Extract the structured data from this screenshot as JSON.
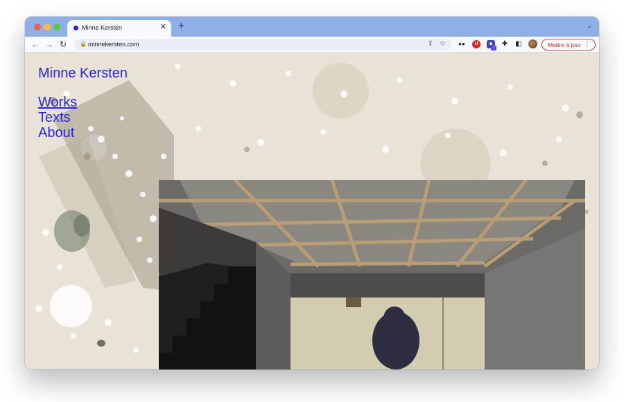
{
  "browser": {
    "tab": {
      "title": "Minne Kersten",
      "close_icon": "close-icon"
    },
    "new_tab_icon": "plus-icon",
    "url": "minnekersten.com",
    "update_button_label": "Mettre à jour",
    "colors": {
      "tab_strip": "#8fb0e6",
      "toolbar": "#f7f9fe",
      "update_accent": "#b3261e"
    }
  },
  "site": {
    "title": "Minne Kersten",
    "nav": [
      {
        "label": "Works",
        "active": true
      },
      {
        "label": "Texts",
        "active": false
      },
      {
        "label": "About",
        "active": false
      }
    ],
    "link_color": "#2a22e6"
  }
}
